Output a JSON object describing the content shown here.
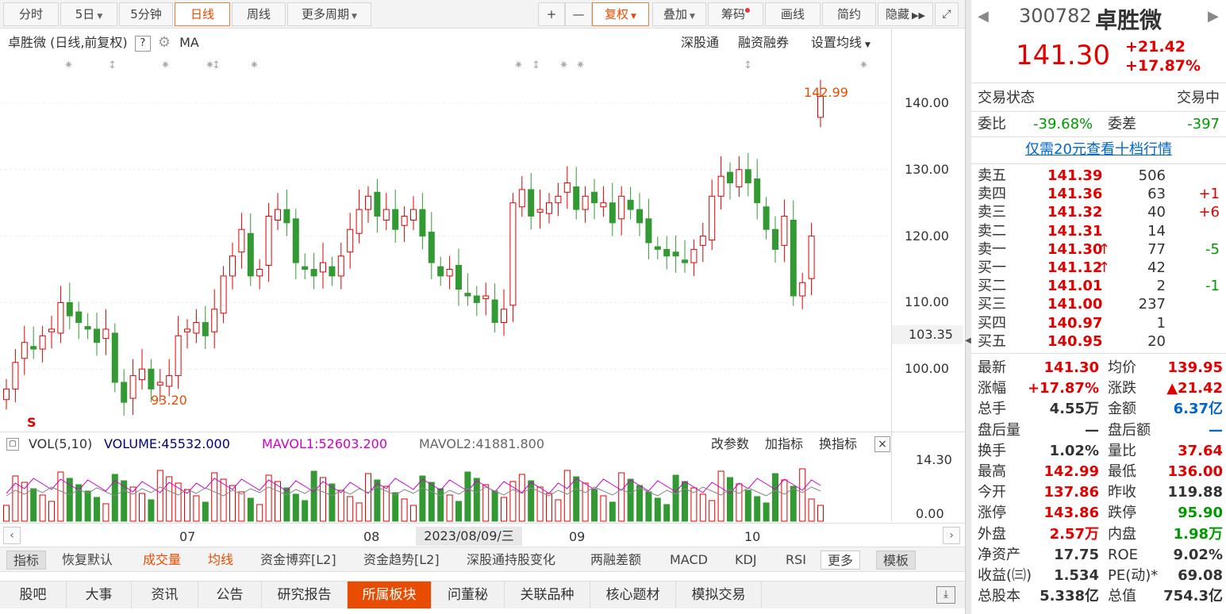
{
  "toolbar": {
    "fenshi": "分时",
    "five_day": "5日",
    "five_min": "5分钟",
    "daily": "日线",
    "weekly": "周线",
    "more_period": "更多周期",
    "plus": "+",
    "minus": "—",
    "fuquan": "复权",
    "overlay": "叠加",
    "chips": "筹码",
    "draw": "画线",
    "simple": "简约",
    "hide": "隐藏"
  },
  "kline": {
    "title": "卓胜微 (日线,前复权)",
    "help": "?",
    "ma": "MA",
    "links": [
      "深股通",
      "融资融券",
      "设置均线"
    ],
    "high_label": "142.99",
    "low_label": "93.20",
    "y_labels": [
      "140.00",
      "130.00",
      "120.00",
      "110.00",
      "100.00"
    ],
    "current_price": "103.35",
    "flag": "S"
  },
  "volume": {
    "name": "VOL(5,10)",
    "volume": "VOLUME:45532.000",
    "mavol1": "MAVOL1:52603.200",
    "mavol2": "MAVOL2:41881.800",
    "actions": [
      "改参数",
      "加指标",
      "换指标"
    ],
    "close": "×",
    "y_top": "14.30",
    "y_bottom": "0.00"
  },
  "x_axis": {
    "labels": [
      "07",
      "08",
      "09",
      "10"
    ],
    "cursor_date": "2023/08/09/三"
  },
  "indicators": {
    "items": [
      "指标",
      "恢复默认",
      "成交量",
      "均线",
      "资金博弈[L2]",
      "资金趋势[L2]",
      "深股通持股变化",
      "两融差额",
      "MACD",
      "KDJ",
      "RSI",
      "更多",
      "模板"
    ]
  },
  "tabs": [
    "股吧",
    "大事",
    "资讯",
    "公告",
    "研究报告",
    "所属板块",
    "问董秘",
    "关联品种",
    "核心题材",
    "模拟交易"
  ],
  "quote": {
    "code": "300782",
    "name": "卓胜微",
    "price": "141.30",
    "change": "+21.42",
    "change_pct": "+17.87%",
    "status_label": "交易状态",
    "status": "交易中",
    "weibi_label": "委比",
    "weibi": "-39.68%",
    "weicha_label": "委差",
    "weicha": "-397",
    "promo": "仅需20元查看十档行情",
    "asks": [
      {
        "label": "卖五",
        "price": "141.39",
        "vol": "506",
        "chg": ""
      },
      {
        "label": "卖四",
        "price": "141.36",
        "vol": "63",
        "chg": "+1"
      },
      {
        "label": "卖三",
        "price": "141.32",
        "vol": "40",
        "chg": "+6"
      },
      {
        "label": "卖二",
        "price": "141.31",
        "vol": "14",
        "chg": ""
      },
      {
        "label": "卖一",
        "price": "141.30",
        "vol": "77",
        "chg": "-5"
      }
    ],
    "bids": [
      {
        "label": "买一",
        "price": "141.12",
        "vol": "42",
        "chg": ""
      },
      {
        "label": "买二",
        "price": "141.01",
        "vol": "2",
        "chg": "-1"
      },
      {
        "label": "买三",
        "price": "141.00",
        "vol": "237",
        "chg": ""
      },
      {
        "label": "买四",
        "price": "140.97",
        "vol": "1",
        "chg": ""
      },
      {
        "label": "买五",
        "price": "140.95",
        "vol": "20",
        "chg": ""
      }
    ],
    "stats": [
      {
        "l1": "最新",
        "v1": "141.30",
        "c1": "red",
        "l2": "均价",
        "v2": "139.95",
        "c2": "red"
      },
      {
        "l1": "涨幅",
        "v1": "+17.87%",
        "c1": "red",
        "l2": "涨跌",
        "v2": "▲21.42",
        "c2": "red"
      },
      {
        "l1": "总手",
        "v1": "4.55万",
        "c1": "",
        "l2": "金额",
        "v2": "6.37亿",
        "c2": "blue"
      },
      {
        "l1": "盘后量",
        "v1": "—",
        "c1": "",
        "l2": "盘后额",
        "v2": "—",
        "c2": "blue"
      },
      {
        "l1": "换手",
        "v1": "1.02%",
        "c1": "",
        "l2": "量比",
        "v2": "37.64",
        "c2": "red"
      },
      {
        "l1": "最高",
        "v1": "142.99",
        "c1": "red",
        "l2": "最低",
        "v2": "136.00",
        "c2": "red"
      },
      {
        "l1": "今开",
        "v1": "137.86",
        "c1": "red",
        "l2": "昨收",
        "v2": "119.88",
        "c2": ""
      },
      {
        "l1": "涨停",
        "v1": "143.86",
        "c1": "red",
        "l2": "跌停",
        "v2": "95.90",
        "c2": "green"
      },
      {
        "l1": "外盘",
        "v1": "2.57万",
        "c1": "red",
        "l2": "内盘",
        "v2": "1.98万",
        "c2": "green"
      },
      {
        "l1": "净资产",
        "v1": "17.75",
        "c1": "",
        "l2": "ROE",
        "v2": "9.02%",
        "c2": ""
      },
      {
        "l1": "收益(㈢)",
        "v1": "1.534",
        "c1": "",
        "l2": "PE(动)*",
        "v2": "69.08",
        "c2": ""
      },
      {
        "l1": "总股本",
        "v1": "5.338亿",
        "c1": "",
        "l2": "总值",
        "v2": "754.3亿",
        "c2": ""
      }
    ]
  },
  "colors": {
    "up": "#e10000",
    "down": "#339933",
    "accent": "#e84c00",
    "mavol1": "#cc00cc"
  }
}
